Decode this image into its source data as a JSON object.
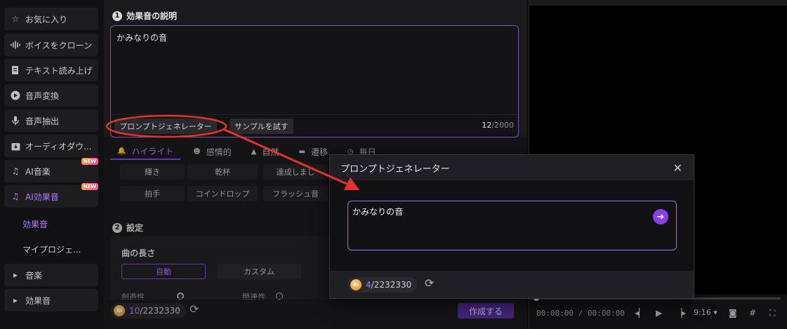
{
  "sidebar": {
    "items": [
      {
        "label": "お気に入り",
        "icon": "star-icon"
      },
      {
        "label": "ボイスをクローン",
        "icon": "waveform-icon"
      },
      {
        "label": "テキスト読み上げ",
        "icon": "doc-speech-icon"
      },
      {
        "label": "音声変換",
        "icon": "voice-change-icon"
      },
      {
        "label": "音声抽出",
        "icon": "microphone-icon"
      },
      {
        "label": "オーディオダウ...",
        "icon": "download-icon"
      },
      {
        "label": "AI音楽",
        "icon": "music-note-icon",
        "badge": "NEW"
      },
      {
        "label": "AI効果音",
        "icon": "sound-effect-icon",
        "badge": "NEW"
      }
    ],
    "sub_items": [
      "効果音",
      "マイプロジェ..."
    ],
    "groups": [
      "音楽",
      "効果音"
    ]
  },
  "section1": {
    "number": "1",
    "title": "効果音の説明",
    "description": "かみなりの音",
    "prompt_gen_button": "プロンプトジェネレーター",
    "sample_button": "サンプルを試す",
    "char_count": "12",
    "char_limit": "/2000"
  },
  "tabs": [
    {
      "label": "ハイライト",
      "icon": "bell-icon"
    },
    {
      "label": "感情的",
      "icon": "emoji-icon"
    },
    {
      "label": "自然",
      "icon": "tree-icon"
    },
    {
      "label": "遷移",
      "icon": "transition-icon"
    },
    {
      "label": "毎日",
      "icon": "clock-icon"
    }
  ],
  "chips": [
    "輝き",
    "乾杯",
    "達成しまし",
    "拍手",
    "コインドロップ",
    "フラッシュ音"
  ],
  "section2": {
    "number": "2",
    "title": "設定",
    "length_label": "曲の長さ",
    "auto_option": "自動",
    "custom_option": "カスタム",
    "creativity_label": "創造性",
    "relevance_label": "関連性"
  },
  "bottom": {
    "credits_used": "10",
    "credits_total": "/2232330",
    "coin_label": "AI",
    "create_button": "作成する"
  },
  "player": {
    "time": "00:00:00 / 00:00:00",
    "ratio": "9:16"
  },
  "modal": {
    "title": "プロンプトジェネレーター",
    "input_text": "かみなりの音",
    "credits_used": "4",
    "credits_total": "/2232330",
    "coin_label": "AI"
  },
  "colors": {
    "accent": "#b67cff",
    "accent_dark": "#5a2fa3",
    "annotation_red": "#e5322d"
  }
}
